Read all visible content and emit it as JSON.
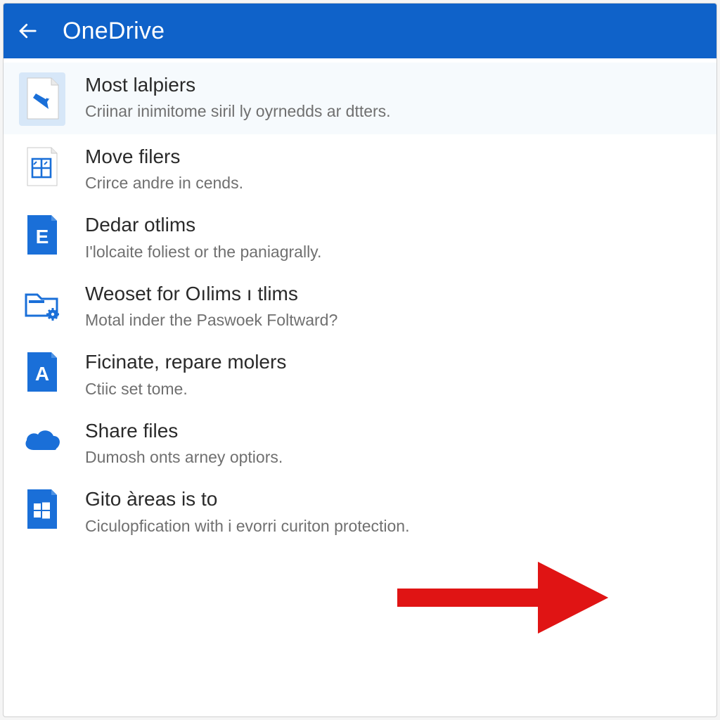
{
  "header": {
    "title": "OneDrive"
  },
  "items": [
    {
      "title": "Most lalpiers",
      "subtitle": "Criinar inimitome siril ly oyrnedds ar dtters."
    },
    {
      "title": "Move filers",
      "subtitle": "Crirce andre in cends."
    },
    {
      "title": "Dedar otlims",
      "subtitle": "I'lolcaite foliest or the paniagrally."
    },
    {
      "title": "Weoset for Oılims ı tlims",
      "subtitle": "Motal inder the Paswoek Foltward?"
    },
    {
      "title": "Ficinate, repare molers",
      "subtitle": "Ctiic set tome."
    },
    {
      "title": "Share files",
      "subtitle": "Dumosh onts arney optiors."
    },
    {
      "title": "Gito àreas is to",
      "subtitle": "Ciculopfication with i evorri curiton protection."
    }
  ],
  "colors": {
    "header_bg": "#0f62c9",
    "accent": "#1a6fd8",
    "arrow": "#e01414"
  }
}
